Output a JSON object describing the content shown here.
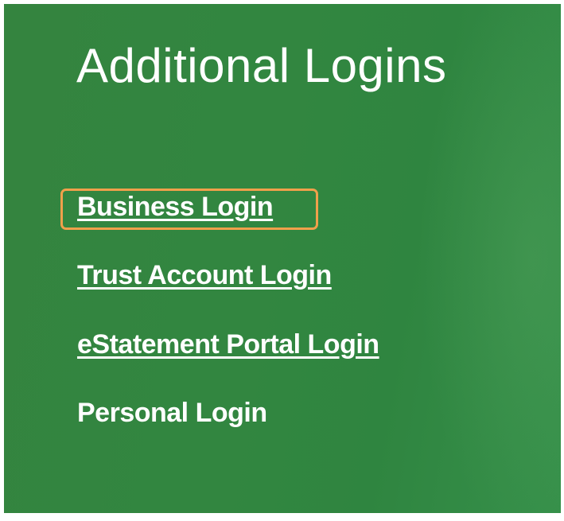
{
  "panel": {
    "title": "Additional Logins",
    "background_color": "#34843f"
  },
  "logins": [
    {
      "label": "Business Login",
      "underlined": true,
      "highlighted": true
    },
    {
      "label": "Trust Account Login",
      "underlined": true,
      "highlighted": false
    },
    {
      "label": "eStatement Portal Login",
      "underlined": true,
      "highlighted": false
    },
    {
      "label": "Personal Login",
      "underlined": false,
      "highlighted": false
    }
  ],
  "highlight": {
    "color": "#f0a04b",
    "target": "Business Login"
  }
}
